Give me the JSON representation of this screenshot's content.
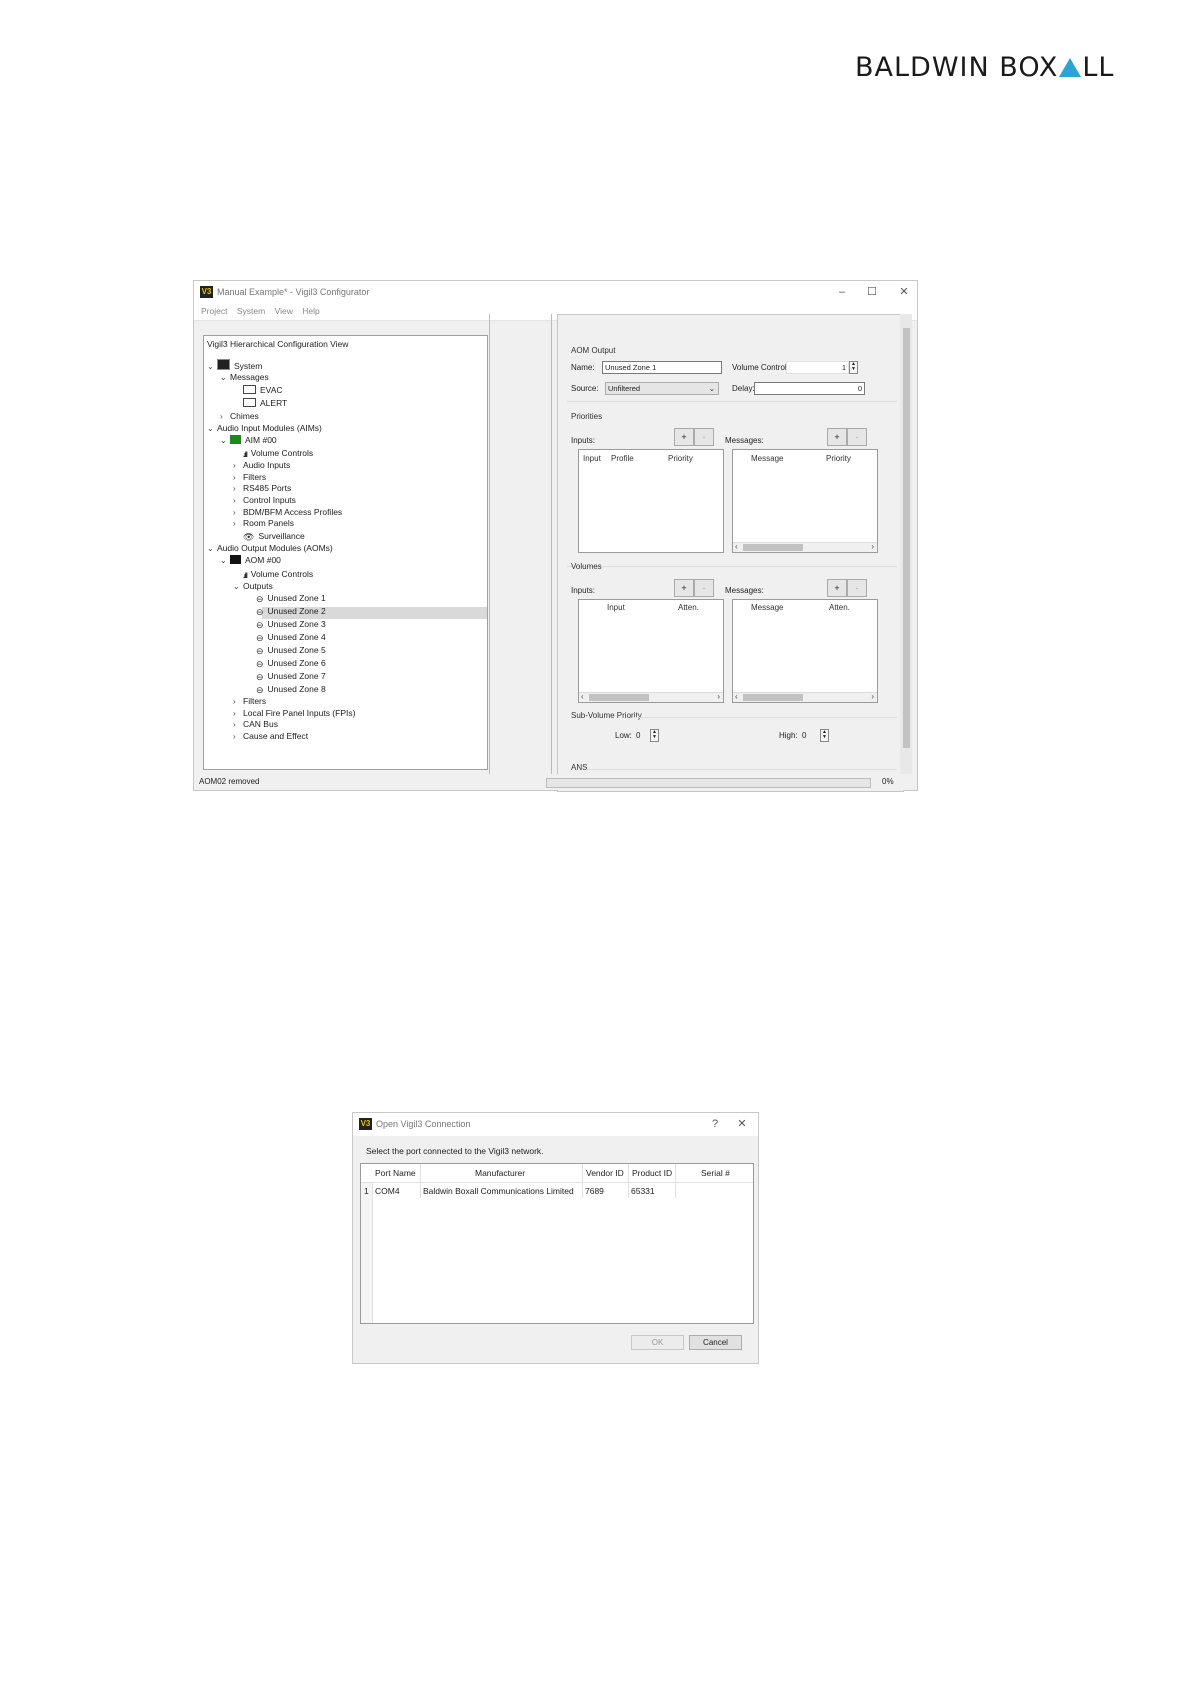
{
  "logo": {
    "left": "BALDWIN BOX",
    "right": "LL"
  },
  "window": {
    "title": "Manual Example* - Vigil3 Configurator",
    "icon_text": "V3",
    "menu": [
      "Project",
      "System",
      "View",
      "Help"
    ],
    "controls": {
      "minimize": "–",
      "maximize": "☐",
      "close": "✕"
    }
  },
  "tree": {
    "title": "Vigil3 Hierarchical Configuration View",
    "items": [
      {
        "label": "System",
        "chev": "⌄"
      },
      {
        "label": "Messages",
        "chev": "⌄"
      },
      {
        "label": "EVAC",
        "chev": ""
      },
      {
        "label": "ALERT",
        "chev": ""
      },
      {
        "label": "Chimes",
        "chev": "›"
      },
      {
        "label": "Audio Input Modules (AIMs)",
        "chev": "⌄"
      },
      {
        "label": "AIM #00",
        "chev": "⌄"
      },
      {
        "label": "Volume Controls",
        "chev": ""
      },
      {
        "label": "Audio Inputs",
        "chev": "›"
      },
      {
        "label": "Filters",
        "chev": "›"
      },
      {
        "label": "RS485 Ports",
        "chev": "›"
      },
      {
        "label": "Control Inputs",
        "chev": "›"
      },
      {
        "label": "BDM/BFM Access Profiles",
        "chev": "›"
      },
      {
        "label": "Room Panels",
        "chev": "›"
      },
      {
        "label": "Surveillance",
        "chev": ""
      },
      {
        "label": "Audio Output Modules (AOMs)",
        "chev": "⌄"
      },
      {
        "label": "AOM #00",
        "chev": "⌄"
      },
      {
        "label": "Volume Controls",
        "chev": ""
      },
      {
        "label": "Outputs",
        "chev": "⌄"
      },
      {
        "label": "Unused Zone 1",
        "chev": ""
      },
      {
        "label": "Unused Zone 2",
        "chev": ""
      },
      {
        "label": "Unused Zone 3",
        "chev": ""
      },
      {
        "label": "Unused Zone 4",
        "chev": ""
      },
      {
        "label": "Unused Zone 5",
        "chev": ""
      },
      {
        "label": "Unused Zone 6",
        "chev": ""
      },
      {
        "label": "Unused Zone 7",
        "chev": ""
      },
      {
        "label": "Unused Zone 8",
        "chev": ""
      },
      {
        "label": "Filters",
        "chev": "›"
      },
      {
        "label": "Local Fire Panel Inputs (FPIs)",
        "chev": "›"
      },
      {
        "label": "CAN Bus",
        "chev": "›"
      },
      {
        "label": "Cause and Effect",
        "chev": "›"
      }
    ]
  },
  "aom": {
    "group": "AOM Output",
    "name_label": "Name:",
    "name_value": "Unused Zone 1",
    "volume_label": "Volume Control:",
    "volume_value": "1",
    "source_label": "Source:",
    "source_value": "Unfiltered",
    "delay_label": "Delay:",
    "delay_value": "0"
  },
  "priorities": {
    "group": "Priorities",
    "inputs_label": "Inputs:",
    "messages_label": "Messages:",
    "input_cols": [
      "Input",
      "Profile",
      "Priority"
    ],
    "message_cols": [
      "Message",
      "Priority"
    ]
  },
  "volumes": {
    "group": "Volumes",
    "inputs_label": "Inputs:",
    "messages_label": "Messages:",
    "input_cols": [
      "Input",
      "Atten."
    ],
    "message_cols": [
      "Message",
      "Atten."
    ]
  },
  "subvol": {
    "group": "Sub-Volume Priority",
    "low_label": "Low:",
    "low_value": "0",
    "high_label": "High:",
    "high_value": "0"
  },
  "ans": {
    "group": "ANS"
  },
  "buttons": {
    "plus": "+",
    "minus": "-"
  },
  "status": {
    "text": "AOM02 removed",
    "percent": "0%"
  },
  "dialog": {
    "title": "Open Vigil3 Connection",
    "help": "?",
    "close": "✕",
    "prompt": "Select the port connected to the Vigil3 network.",
    "columns": [
      "Port Name",
      "Manufacturer",
      "Vendor ID",
      "Product ID",
      "Serial #"
    ],
    "rows": [
      {
        "index": "1",
        "port": "COM4",
        "manufacturer": "Baldwin Boxall Communications Limited",
        "vendor": "7689",
        "product": "65331",
        "serial": ""
      }
    ],
    "ok": "OK",
    "cancel": "Cancel"
  }
}
